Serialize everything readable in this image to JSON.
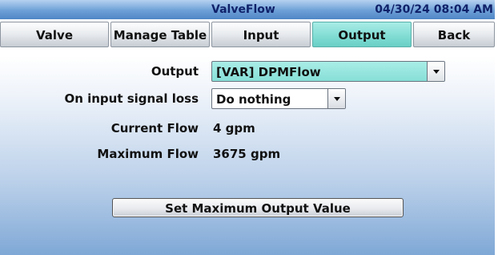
{
  "header": {
    "title": "ValveFlow",
    "datetime": "04/30/24 08:04 AM"
  },
  "tabs": [
    {
      "label": "Valve",
      "active": false
    },
    {
      "label": "Manage Table",
      "active": false
    },
    {
      "label": "Input",
      "active": false
    },
    {
      "label": "Output",
      "active": true
    },
    {
      "label": "Back",
      "active": false
    }
  ],
  "form": {
    "output": {
      "label": "Output",
      "value": "[VAR] DPMFlow"
    },
    "signal_loss": {
      "label": "On input signal loss",
      "value": "Do nothing"
    },
    "current_flow": {
      "label": "Current Flow",
      "value": "4 gpm"
    },
    "max_flow": {
      "label": "Maximum Flow",
      "value": "3675 gpm"
    }
  },
  "actions": {
    "set_max_output_label": "Set Maximum Output Value"
  },
  "colors": {
    "active_tab": "#7fdcd3",
    "title_bar": "#6d9fd7",
    "title_text": "#10226a"
  }
}
